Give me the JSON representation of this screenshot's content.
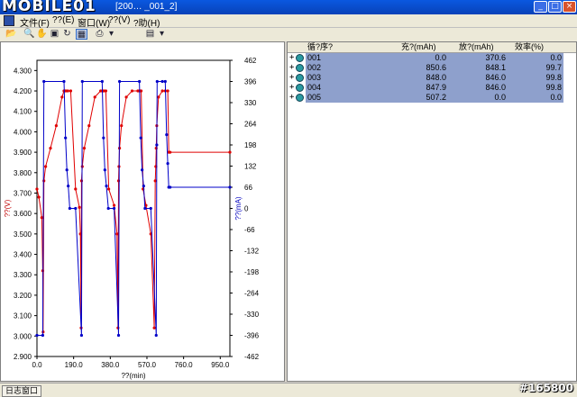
{
  "titlebar": {
    "logo": "MOBILE01",
    "title": "[200… _001_2]",
    "min": "_",
    "max": "□",
    "close": "×"
  },
  "menu": {
    "items": [
      "文件(F)",
      "??(E)",
      "窗口(W)",
      "??(V)",
      "?助(H)"
    ]
  },
  "toolbar": {
    "icons": [
      "folder-open-icon",
      "zoom-icon",
      "hand-icon",
      "fit-icon",
      "refresh-icon",
      "chart-icon",
      "copy-icon",
      "monitor-icon"
    ]
  },
  "table": {
    "headers": [
      "循?序?",
      "充?(mAh)",
      "放?(mAh)",
      "效率(%)"
    ],
    "rows": [
      {
        "id": "001",
        "charge": "0.0",
        "discharge": "370.6",
        "efficiency": "0.0"
      },
      {
        "id": "002",
        "charge": "850.6",
        "discharge": "848.1",
        "efficiency": "99.7"
      },
      {
        "id": "003",
        "charge": "848.0",
        "discharge": "846.0",
        "efficiency": "99.8"
      },
      {
        "id": "004",
        "charge": "847.9",
        "discharge": "846.0",
        "efficiency": "99.8"
      },
      {
        "id": "005",
        "charge": "507.2",
        "discharge": "0.0",
        "efficiency": "0.0"
      }
    ]
  },
  "status": {
    "log_tab": "日志窗口"
  },
  "watermark": "#165800",
  "chart_data": {
    "type": "line",
    "xlabel": "??(min)",
    "ylabel_left": "??(V)",
    "ylabel_right": "??(mA)",
    "x_ticks": [
      0.0,
      190.0,
      380.0,
      570.0,
      760.0,
      950.0
    ],
    "y_left_ticks": [
      2.9,
      3.0,
      3.1,
      3.2,
      3.3,
      3.4,
      3.5,
      3.6,
      3.7,
      3.8,
      3.9,
      4.0,
      4.1,
      4.2,
      4.3
    ],
    "y_right_ticks": [
      -462,
      -396,
      -330,
      -264,
      -198,
      -132,
      -66,
      0,
      66,
      132,
      198,
      264,
      330,
      396,
      462
    ],
    "xlim": [
      0,
      1000
    ],
    "ylim_left": [
      2.9,
      4.35
    ],
    "ylim_right": [
      -462,
      462
    ],
    "series": [
      {
        "color": "#e00000",
        "axis": "left",
        "x": [
          0,
          10,
          25,
          30,
          32,
          36,
          45,
          70,
          100,
          130,
          140,
          145,
          150,
          160,
          175,
          200,
          220,
          225,
          229,
          231,
          235,
          245,
          270,
          300,
          330,
          338,
          342,
          347,
          357,
          372,
          400,
          415,
          420,
          423,
          425,
          428,
          438,
          463,
          493,
          523,
          531,
          535,
          540,
          550,
          565,
          590,
          608,
          613,
          616,
          618,
          621,
          630,
          650,
          665,
          678,
          683,
          690,
          1000
        ],
        "y": [
          3.72,
          3.68,
          3.58,
          3.32,
          3.02,
          3.76,
          3.83,
          3.92,
          4.03,
          4.17,
          4.2,
          4.2,
          4.2,
          4.2,
          4.2,
          3.72,
          3.63,
          3.5,
          3.04,
          3.76,
          3.83,
          3.92,
          4.03,
          4.17,
          4.2,
          4.2,
          4.2,
          4.2,
          4.2,
          3.72,
          3.64,
          3.5,
          3.04,
          3.76,
          3.83,
          3.92,
          4.03,
          4.17,
          4.2,
          4.2,
          4.2,
          4.2,
          4.2,
          3.72,
          3.64,
          3.5,
          3.04,
          3.76,
          3.83,
          3.92,
          4.03,
          4.17,
          4.2,
          4.2,
          4.2,
          3.9,
          3.9,
          3.9
        ]
      },
      {
        "color": "#0000c8",
        "axis": "right",
        "x": [
          0,
          30,
          36,
          140,
          148,
          155,
          162,
          170,
          200,
          231,
          235,
          338,
          345,
          352,
          360,
          370,
          400,
          423,
          428,
          531,
          538,
          545,
          553,
          560,
          590,
          618,
          621,
          623,
          650,
          665,
          672,
          678,
          683,
          690,
          1000
        ],
        "y": [
          -396,
          -396,
          396,
          396,
          220,
          120,
          70,
          0,
          0,
          -396,
          396,
          396,
          220,
          120,
          70,
          0,
          0,
          -396,
          396,
          396,
          220,
          120,
          70,
          0,
          0,
          -396,
          198,
          396,
          396,
          396,
          230,
          140,
          66,
          66,
          66
        ]
      }
    ]
  }
}
